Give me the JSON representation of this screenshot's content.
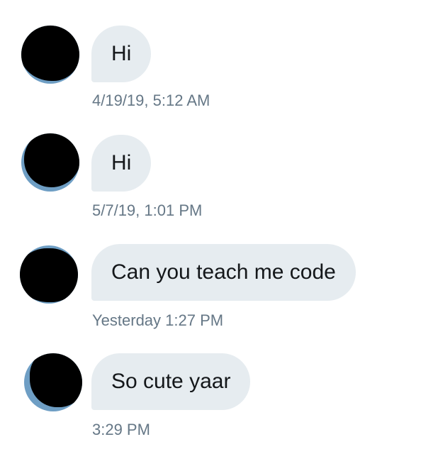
{
  "messages": [
    {
      "text": "Hi",
      "timestamp": "4/19/19, 5:12 AM"
    },
    {
      "text": "Hi",
      "timestamp": "5/7/19, 1:01 PM"
    },
    {
      "text": "Can you teach me code",
      "timestamp": "Yesterday 1:27 PM"
    },
    {
      "text": "So cute yaar",
      "timestamp": "3:29 PM"
    }
  ],
  "colors": {
    "bubble": "#e6ecf0",
    "message_text": "#14171a",
    "timestamp_text": "#657786",
    "avatar_edge": "#6e9ec4",
    "redaction": "#000000"
  },
  "icons": {
    "avatar": "redacted-avatar-icon"
  }
}
